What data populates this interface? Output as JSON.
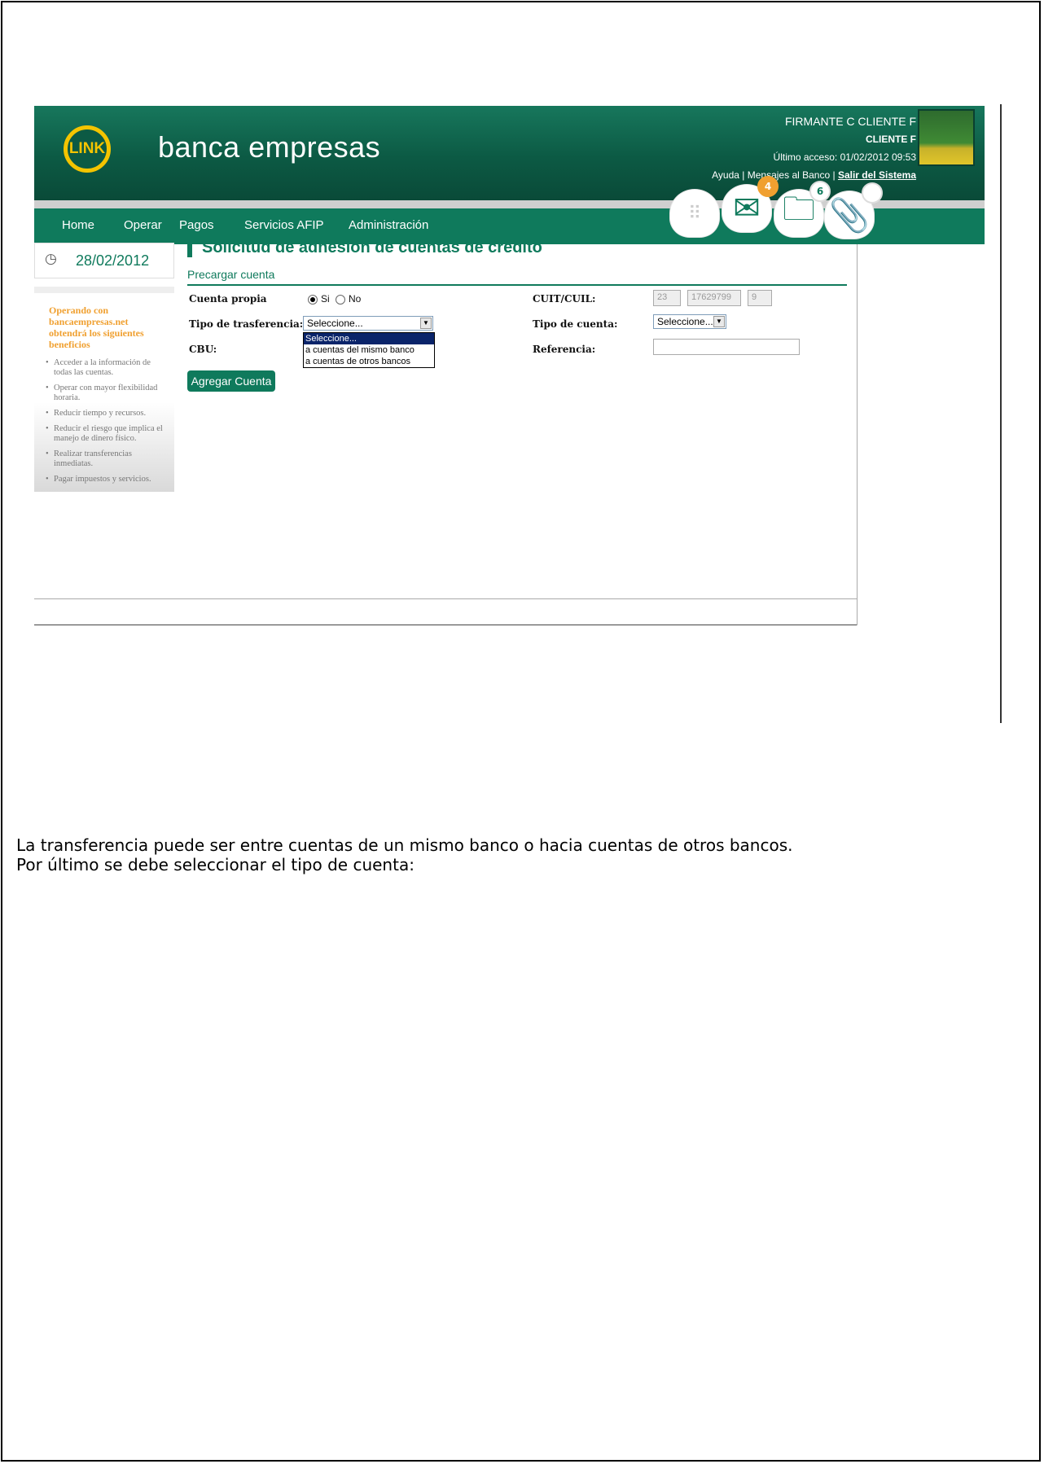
{
  "header": {
    "logo_text": "LINK",
    "brand": "banca empresas",
    "user_name": "FIRMANTE C CLIENTE F",
    "client": "CLIENTE F",
    "last_access": "Último acceso: 01/02/2012 09:53",
    "link_help": "Ayuda",
    "link_messages": "Mensajes al Banco",
    "link_exit": "Salir del Sistema",
    "separator": "|"
  },
  "nav": {
    "items": [
      "Home",
      "Operar",
      "Pagos",
      "Servicios AFIP",
      "Administración"
    ],
    "badges": [
      "4",
      "6"
    ]
  },
  "sidebar": {
    "date": "28/02/2012",
    "promo_title": "Operando con bancaempresas.net obtendrá los siguientes beneficios",
    "benefits": [
      "Acceder a la información de todas las cuentas.",
      "Operar con mayor flexibilidad horaria.",
      "Reducir tiempo y recursos.",
      "Reducir el riesgo que implica el manejo de dinero físico.",
      "Realizar transferencias inmediatas.",
      "Pagar impuestos y servicios."
    ]
  },
  "form": {
    "title": "Solicitud de adhesión de cuentas de crédito",
    "subtitle": "Precargar cuenta",
    "cuenta_propia_label": "Cuenta propia",
    "radio_si": "Si",
    "radio_no": "No",
    "tipo_transferencia_label": "Tipo de trasferencia:",
    "tipo_transferencia_value": "Seleccione...",
    "dropdown_options": [
      "Seleccione...",
      "a cuentas del mismo banco",
      "a cuentas de otros bancos"
    ],
    "cbu_label": "CBU:",
    "cuit_label": "CUIT/CUIL:",
    "cuit_parts": [
      "23",
      "17629799",
      "9"
    ],
    "tipo_cuenta_label": "Tipo de cuenta:",
    "tipo_cuenta_value": "Seleccione...",
    "referencia_label": "Referencia:",
    "referencia_value": "",
    "add_button": "Agregar Cuenta"
  },
  "document": {
    "paragraph1": "La transferencia puede ser entre cuentas de un mismo banco o hacia cuentas de otros bancos.",
    "paragraph2": "Por último se debe seleccionar el tipo de cuenta:"
  }
}
